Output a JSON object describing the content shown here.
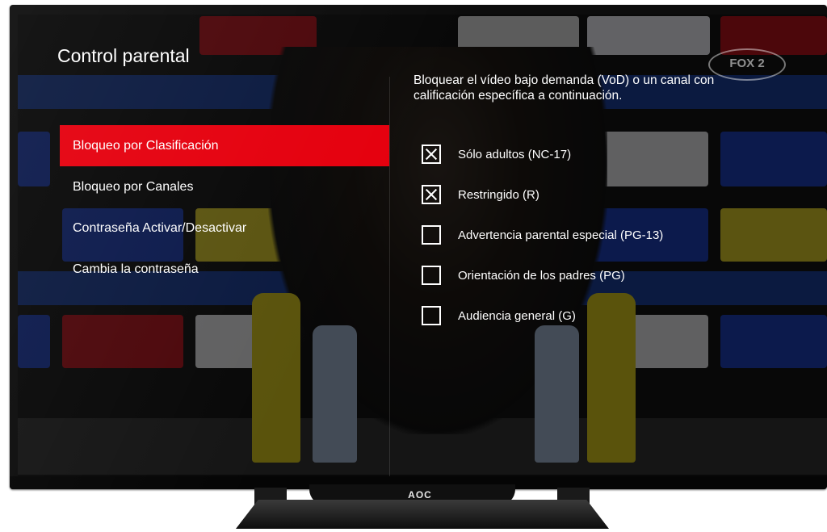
{
  "screen": {
    "title": "Control parental",
    "channel_logo": "FOX 2",
    "brand": "AOC"
  },
  "menu": {
    "items": [
      {
        "label": "Bloqueo por Clasificación",
        "active": true
      },
      {
        "label": "Bloqueo por Canales",
        "active": false
      },
      {
        "label": "Contraseña Activar/Desactivar",
        "active": false
      },
      {
        "label": "Cambia la contraseña",
        "active": false
      }
    ]
  },
  "panel": {
    "description": "Bloquear el vídeo bajo demanda (VoD) o un canal con calificación específica a continuación.",
    "options": [
      {
        "label": "Sólo adultos (NC-17)",
        "checked": true
      },
      {
        "label": "Restringido (R)",
        "checked": true
      },
      {
        "label": "Advertencia parental especial (PG-13)",
        "checked": false
      },
      {
        "label": "Orientación de los padres (PG)",
        "checked": false
      },
      {
        "label": "Audiencia general (G)",
        "checked": false
      }
    ]
  },
  "colors": {
    "accent": "#e5000e",
    "text": "#ffffff"
  }
}
